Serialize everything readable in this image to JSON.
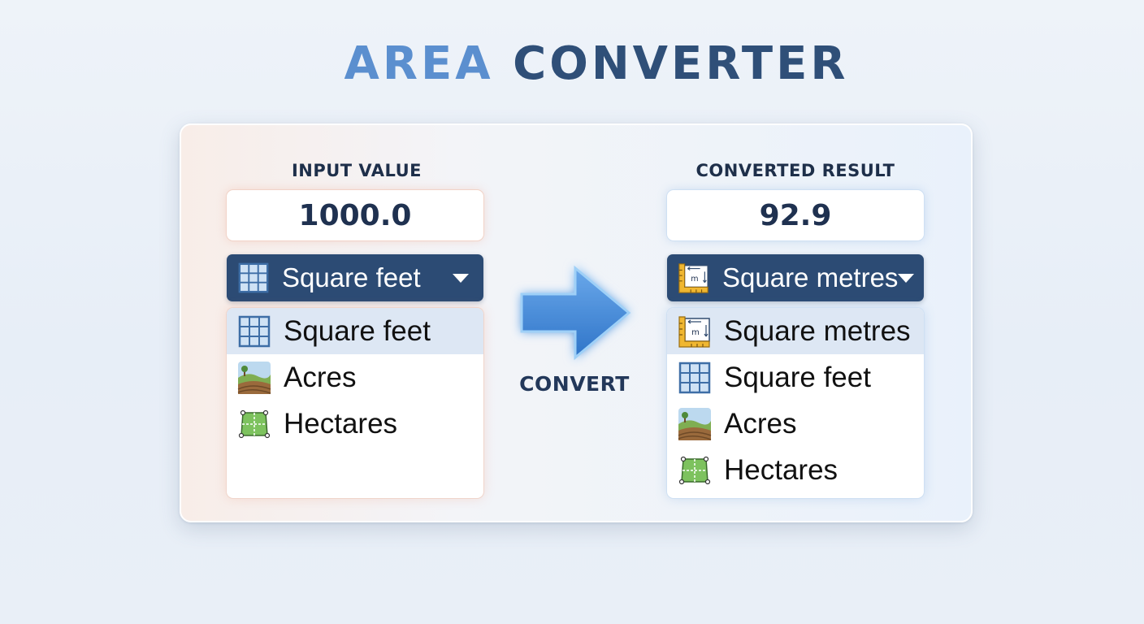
{
  "title": {
    "part1": "AREA",
    "part2": "CONVERTER"
  },
  "input": {
    "label": "INPUT VALUE",
    "value": "1000.0",
    "selected_unit": "Square feet",
    "selected_icon": "grid-icon",
    "options": [
      {
        "label": "Square feet",
        "icon": "grid-icon",
        "selected": true
      },
      {
        "label": "Acres",
        "icon": "farmland-icon",
        "selected": false
      },
      {
        "label": "Hectares",
        "icon": "field-plot-icon",
        "selected": false
      }
    ]
  },
  "convert": {
    "label": "CONVERT",
    "icon": "right-arrow-icon"
  },
  "output": {
    "label": "CONVERTED RESULT",
    "value": "92.9",
    "selected_unit": "Square metres",
    "selected_icon": "ruler-square-icon",
    "options": [
      {
        "label": "Square metres",
        "icon": "ruler-square-icon",
        "selected": true
      },
      {
        "label": "Square feet",
        "icon": "grid-icon",
        "selected": false
      },
      {
        "label": "Acres",
        "icon": "farmland-icon",
        "selected": false
      },
      {
        "label": "Hectares",
        "icon": "field-plot-icon",
        "selected": false
      }
    ]
  },
  "colors": {
    "title_accent": "#5b8fcf",
    "title_main": "#2f4f78",
    "dropdown_bg": "#2c4b74",
    "arrow": "#3f86d8",
    "selected_option_bg": "#dde7f4"
  }
}
